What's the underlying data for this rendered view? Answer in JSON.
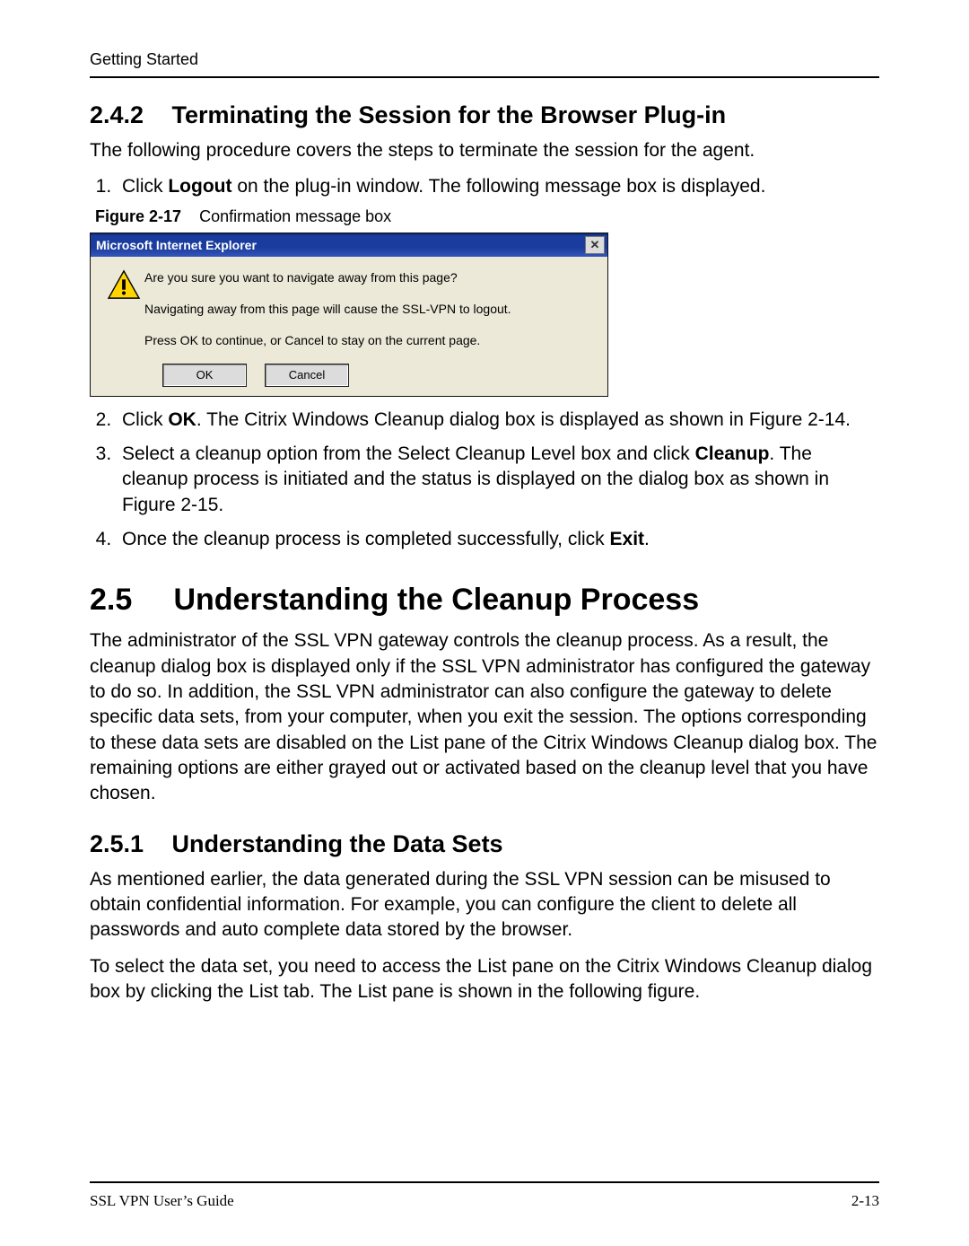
{
  "running_head": "Getting Started",
  "section_242": {
    "number": "2.4.2",
    "title": "Terminating the Session for the Browser Plug-in",
    "intro": "The following procedure covers the steps to terminate the session for the agent.",
    "steps": {
      "s1_pre": "Click ",
      "s1_bold": "Logout",
      "s1_post": " on the plug-in window. The following message box is displayed.",
      "s2_pre": "Click ",
      "s2_bold": "OK",
      "s2_post": ". The Citrix Windows Cleanup dialog box is displayed as shown in Figure 2-14.",
      "s3_pre": "Select a cleanup option from the Select Cleanup Level box and click ",
      "s3_bold": "Cleanup",
      "s3_post": ". The cleanup process is initiated and the status is displayed on the dialog box as shown in Figure 2-15.",
      "s4_pre": "Once the cleanup process is completed successfully, click ",
      "s4_bold": "Exit",
      "s4_post": "."
    },
    "figure": {
      "label": "Figure 2-17",
      "caption": "Confirmation message box"
    }
  },
  "dialog": {
    "title": "Microsoft Internet Explorer",
    "line1": "Are you sure you want to navigate away from this page?",
    "line2": "Navigating away from this page will cause the SSL-VPN to logout.",
    "line3": "Press OK to continue, or Cancel to stay on the current page.",
    "ok": "OK",
    "cancel": "Cancel",
    "close_glyph": "✕"
  },
  "section_25": {
    "number": "2.5",
    "title": "Understanding the Cleanup Process",
    "para": "The administrator of the SSL VPN gateway controls the cleanup process. As a result, the cleanup dialog box is displayed only if the SSL VPN administrator has configured the gateway to do so. In addition, the SSL VPN administrator can also configure the gateway to delete specific data sets, from your computer, when you exit the session. The options corresponding to these data sets are disabled on the List pane of the Citrix Windows Cleanup dialog box. The remaining options are either grayed out or activated based on the cleanup level that you have chosen."
  },
  "section_251": {
    "number": "2.5.1",
    "title": "Understanding the Data Sets",
    "para1": "As mentioned earlier, the data generated during the SSL VPN session can be misused to obtain confidential information. For example, you can configure the client to delete all passwords and auto complete data stored by the browser.",
    "para2": "To select the data set, you need to access the List pane on the Citrix Windows Cleanup dialog box by clicking the List tab. The List pane is shown in the following figure."
  },
  "footer": {
    "left": "SSL VPN User’s Guide",
    "right": "2-13"
  }
}
